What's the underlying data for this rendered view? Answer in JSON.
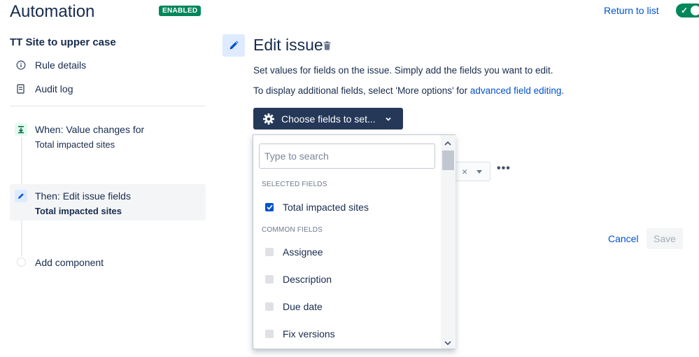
{
  "header": {
    "title": "Automation",
    "status_badge": "ENABLED",
    "return_link": "Return to list",
    "toggle_checkmark": "✓"
  },
  "sidebar": {
    "rule_name": "TT Site to upper case",
    "nav": [
      {
        "label": "Rule details",
        "icon": "info-icon"
      },
      {
        "label": "Audit log",
        "icon": "document-icon"
      }
    ],
    "components": [
      {
        "title": "When: Value changes for",
        "subtitle": "Total impacted sites",
        "icon": "trigger-icon",
        "accent": "#e3fcef"
      },
      {
        "title": "Then: Edit issue fields",
        "subtitle": "Total impacted sites",
        "icon": "pencil-icon",
        "accent": "#deebff",
        "selected": true
      }
    ],
    "add_component": "Add component"
  },
  "main": {
    "title": "Edit issue",
    "description": "Set values for fields on the issue. Simply add the fields you want to edit.",
    "more_prefix": "To display additional fields, select 'More options' for ",
    "more_link": "advanced field editing",
    "more_suffix": ".",
    "choose_button": "Choose fields to set...",
    "background_field_clear": "×",
    "more_actions": "•••",
    "cancel": "Cancel",
    "save": "Save"
  },
  "dropdown": {
    "search_placeholder": "Type to search",
    "selected_label": "SELECTED FIELDS",
    "selected": [
      {
        "label": "Total impacted sites",
        "checked": true
      }
    ],
    "common_label": "COMMON FIELDS",
    "common": [
      {
        "label": "Assignee",
        "checked": false
      },
      {
        "label": "Description",
        "checked": false
      },
      {
        "label": "Due date",
        "checked": false
      },
      {
        "label": "Fix versions",
        "checked": false
      }
    ]
  },
  "colors": {
    "accent": "#0052cc",
    "enabled": "#00875a",
    "dark_button": "#253858"
  }
}
